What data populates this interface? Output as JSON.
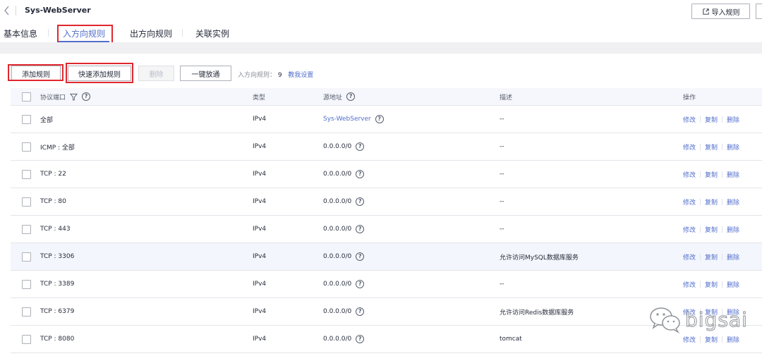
{
  "header": {
    "back_icon": "chevron-left-icon",
    "title": "Sys-WebServer",
    "import_label": "导入规则"
  },
  "tabs": [
    {
      "label": "基本信息"
    },
    {
      "label": "入方向规则"
    },
    {
      "label": "出方向规则"
    },
    {
      "label": "关联实例"
    }
  ],
  "toolbar": {
    "add_label": "添加规则",
    "quick_add_label": "快速添加规则",
    "delete_label": "删除",
    "allow_all_label": "一键放通",
    "rule_count_label": "入方向规则：",
    "rule_count": "9",
    "teach_link": "教我设置"
  },
  "table": {
    "columns": {
      "protocol": "协议端口",
      "type": "类型",
      "source": "源地址",
      "description": "描述",
      "actions": "操作"
    },
    "action_labels": {
      "edit": "修改",
      "copy": "复制",
      "delete": "删除"
    },
    "rows": [
      {
        "protocol": "全部",
        "type": "IPv4",
        "source": "Sys-WebServer",
        "description": "--"
      },
      {
        "protocol": "ICMP : 全部",
        "type": "IPv4",
        "source": "0.0.0.0/0",
        "description": "--"
      },
      {
        "protocol": "TCP : 22",
        "type": "IPv4",
        "source": "0.0.0.0/0",
        "description": "--"
      },
      {
        "protocol": "TCP : 80",
        "type": "IPv4",
        "source": "0.0.0.0/0",
        "description": "--"
      },
      {
        "protocol": "TCP : 443",
        "type": "IPv4",
        "source": "0.0.0.0/0",
        "description": "--"
      },
      {
        "protocol": "TCP : 3306",
        "type": "IPv4",
        "source": "0.0.0.0/0",
        "description": "允许访问MySQL数据库服务"
      },
      {
        "protocol": "TCP : 3389",
        "type": "IPv4",
        "source": "0.0.0.0/0",
        "description": "--"
      },
      {
        "protocol": "TCP : 6379",
        "type": "IPv4",
        "source": "0.0.0.0/0",
        "description": "允许访问Redis数据库服务"
      },
      {
        "protocol": "TCP : 8080",
        "type": "IPv4",
        "source": "0.0.0.0/0",
        "description": "tomcat"
      }
    ]
  },
  "watermark": {
    "text": "bigsai"
  },
  "colors": {
    "accent": "#526ecc",
    "highlight": "#e0282e"
  }
}
